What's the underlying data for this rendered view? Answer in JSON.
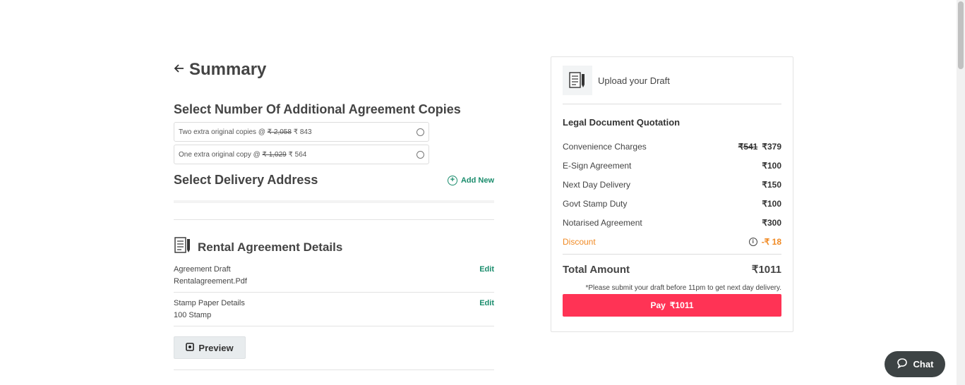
{
  "summary": {
    "title": "Summary",
    "back_icon": "arrow-left-icon"
  },
  "copies": {
    "title": "Select Number Of Additional Agreement Copies",
    "options": [
      {
        "label": "Two extra original copies @ ",
        "old_price": "₹ 2,058",
        "new_price": " ₹ 843"
      },
      {
        "label": "One extra original copy @ ",
        "old_price": "₹ 1,029",
        "new_price": " ₹ 564"
      }
    ]
  },
  "delivery": {
    "title": "Select Delivery Address",
    "add_new": "Add New"
  },
  "details": {
    "title": "Rental Agreement Details",
    "rows": [
      {
        "label": "Agreement Draft",
        "value": "Rentalagreement.Pdf",
        "action": "Edit"
      },
      {
        "label": "Stamp Paper Details",
        "value": "100 Stamp",
        "action": "Edit"
      }
    ],
    "preview": "Preview"
  },
  "quotation": {
    "upload_label": "Upload your Draft",
    "title": "Legal Document Quotation",
    "charges": [
      {
        "label": "Convenience Charges",
        "old": "₹541",
        "value": "₹379"
      },
      {
        "label": "E-Sign Agreement",
        "value": "₹100"
      },
      {
        "label": "Next Day Delivery",
        "value": "₹150"
      },
      {
        "label": "Govt Stamp Duty",
        "value": "₹100"
      },
      {
        "label": "Notarised Agreement",
        "value": "₹300"
      }
    ],
    "discount": {
      "label": "Discount",
      "value": "-₹ 18"
    },
    "total_label": "Total Amount",
    "total_value": "₹1011",
    "note": "*Please submit your draft before 11pm to get next day delivery.",
    "pay_label": "Pay",
    "pay_amount": "₹1011"
  },
  "chat": {
    "label": "Chat"
  },
  "colors": {
    "accent": "#ff3355",
    "link": "#1a8c6c",
    "discount": "#f08a24"
  }
}
